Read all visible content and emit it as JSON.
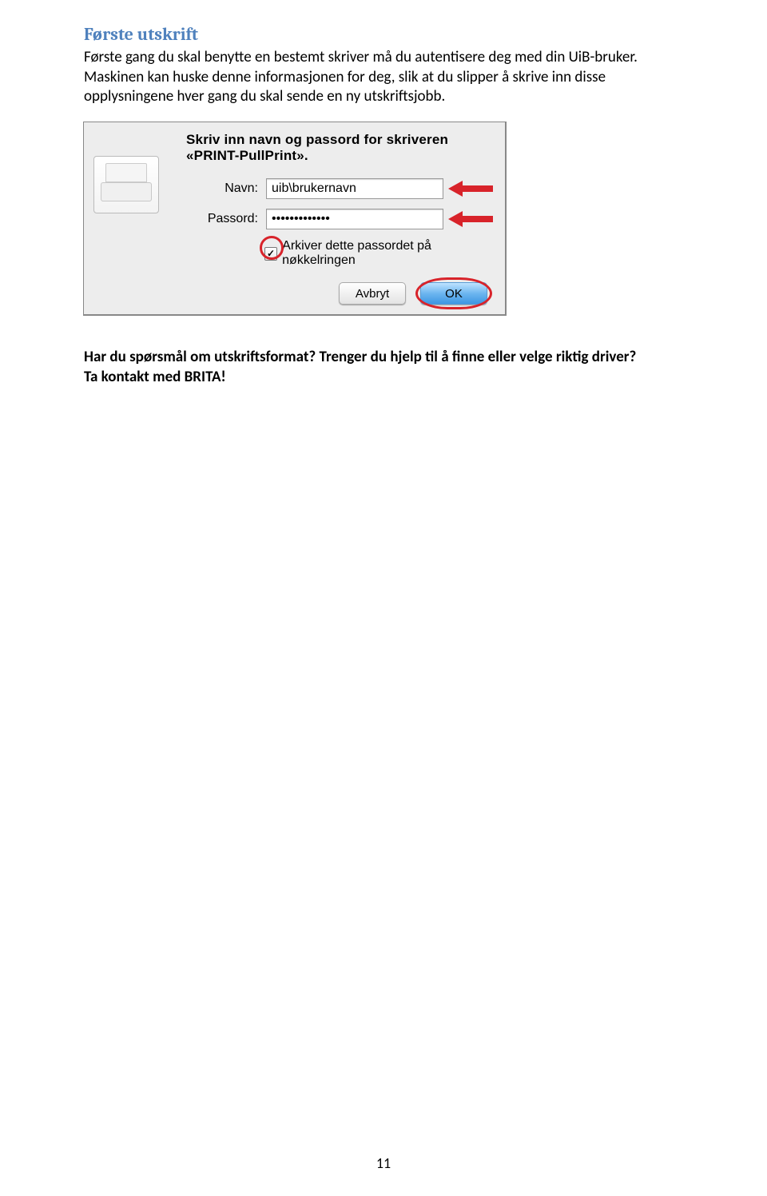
{
  "heading": "Første utskrift",
  "paragraph1": "Første gang du skal benytte en bestemt skriver må du autentisere deg med din UiB-bruker. Maskinen kan huske denne informasjonen for deg, slik at du slipper å skrive inn disse opplysningene hver gang du skal sende en ny utskriftsjobb.",
  "dialog": {
    "intro": "Skriv inn navn og passord for skriveren «PRINT-PullPrint».",
    "name_label": "Navn:",
    "name_value": "uib\\brukernavn",
    "password_label": "Passord:",
    "password_value": "•••••••••••••",
    "keychain_label": "Arkiver dette passordet på nøkkelringen",
    "cancel": "Avbryt",
    "ok": "OK",
    "check_glyph": "✓"
  },
  "question1": "Har du spørsmål om utskriftsformat? Trenger du hjelp til å finne eller velge riktig driver?",
  "question2": "Ta kontakt med BRITA!",
  "page_number": "11"
}
